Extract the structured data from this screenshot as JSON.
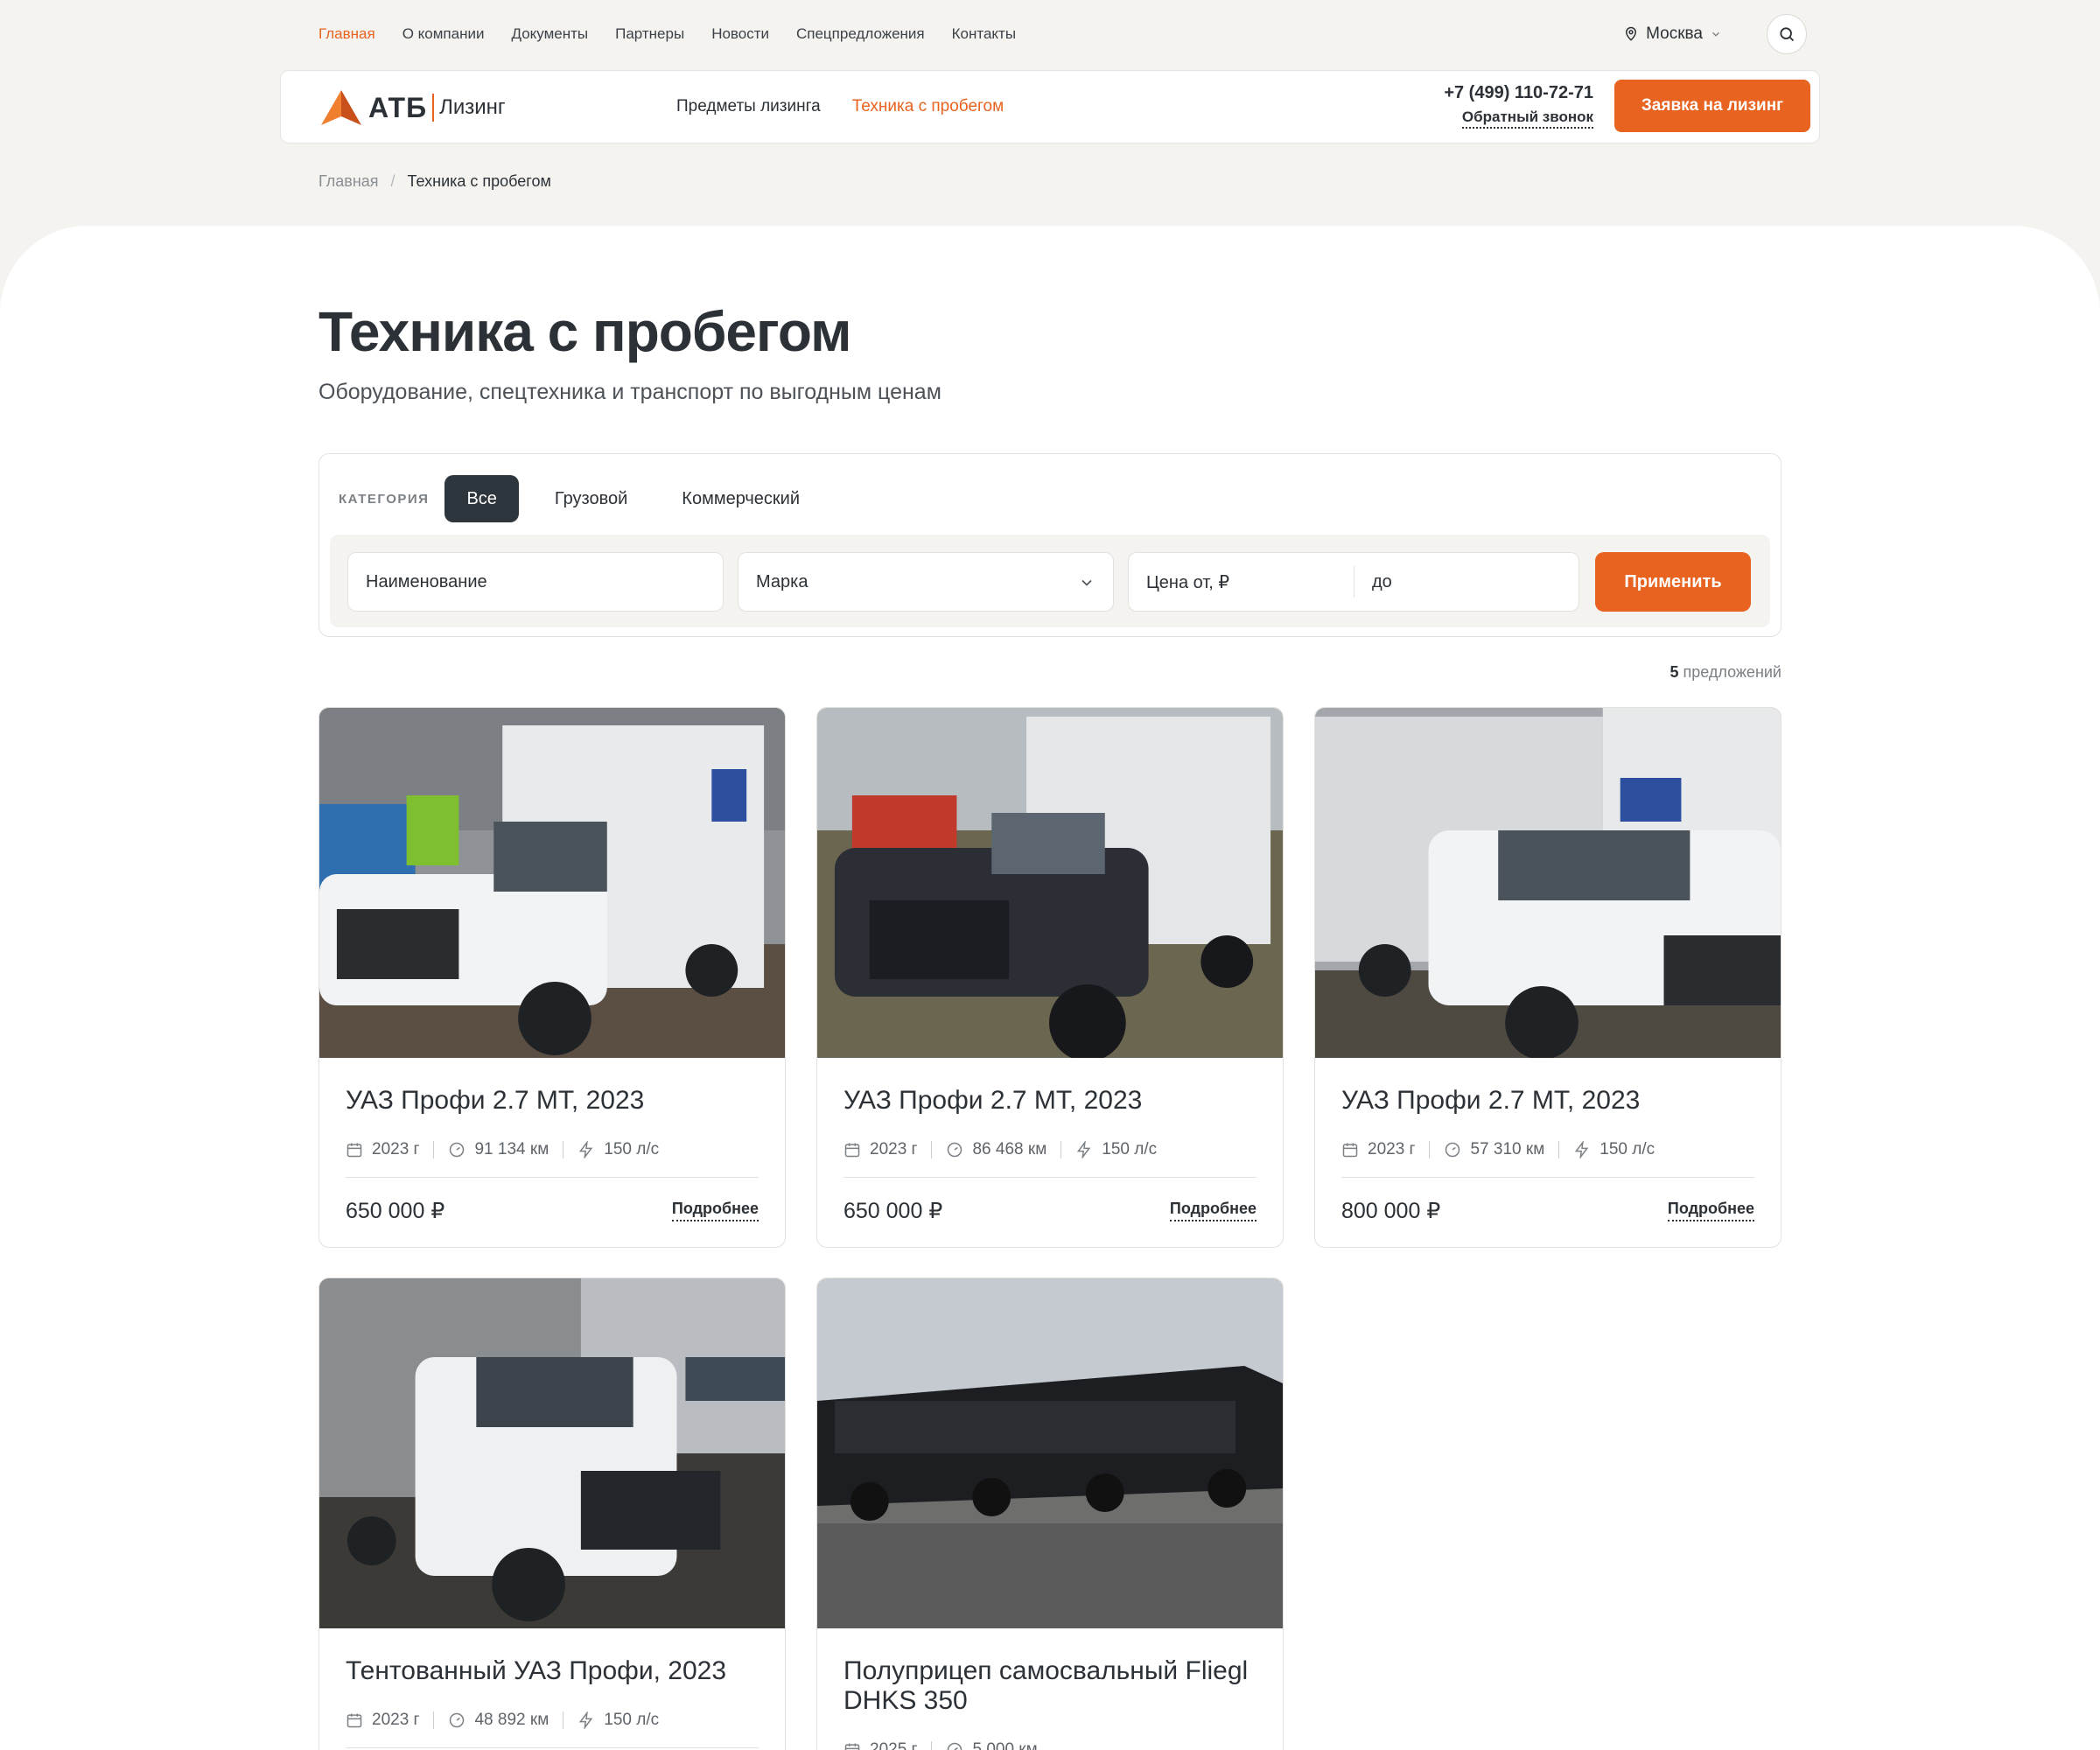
{
  "topnav": {
    "links": [
      "Главная",
      "О компании",
      "Документы",
      "Партнеры",
      "Новости",
      "Спецпредложения",
      "Контакты"
    ],
    "city": "Москва"
  },
  "header": {
    "logo_abbr": "АТБ",
    "logo_word": "Лизинг",
    "nav": [
      "Предметы лизинга",
      "Техника с пробегом"
    ],
    "phone": "+7 (499) 110-72-71",
    "callback": "Обратный звонок",
    "apply": "Заявка на лизинг"
  },
  "breadcrumb": {
    "home": "Главная",
    "separator": "/",
    "current": "Техника с пробегом"
  },
  "page": {
    "title": "Техника с пробегом",
    "subtitle": "Оборудование, спецтехника и транспорт по выгодным ценам"
  },
  "filter": {
    "category_label": "КАТЕГОРИЯ",
    "categories": [
      "Все",
      "Грузовой",
      "Коммерческий"
    ],
    "name_placeholder": "Наименование",
    "brand_placeholder": "Марка",
    "price_from": "Цена от, ₽",
    "price_to": "до",
    "apply": "Применить"
  },
  "results": {
    "count": "5",
    "label": "предложений"
  },
  "cards": [
    {
      "title": "УАЗ Профи 2.7 MT, 2023",
      "year": "2023 г",
      "mileage": "91 134 км",
      "power": "150 л/с",
      "price": "650 000 ₽",
      "more": "Подробнее"
    },
    {
      "title": "УАЗ Профи 2.7 MT, 2023",
      "year": "2023 г",
      "mileage": "86 468 км",
      "power": "150 л/с",
      "price": "650 000 ₽",
      "more": "Подробнее"
    },
    {
      "title": "УАЗ Профи 2.7 MT, 2023",
      "year": "2023 г",
      "mileage": "57 310 км",
      "power": "150 л/с",
      "price": "800 000 ₽",
      "more": "Подробнее"
    },
    {
      "title": "Тентованный УАЗ Профи, 2023",
      "year": "2023 г",
      "mileage": "48 892 км",
      "power": "150 л/с"
    },
    {
      "title": "Полуприцеп самосвальный Fliegl DHKS 350",
      "year": "2025 г",
      "mileage": "5 000 км"
    }
  ],
  "colors": {
    "accent": "#e8631f",
    "dark": "#2d363c",
    "page_bg": "#f4f3f0"
  }
}
